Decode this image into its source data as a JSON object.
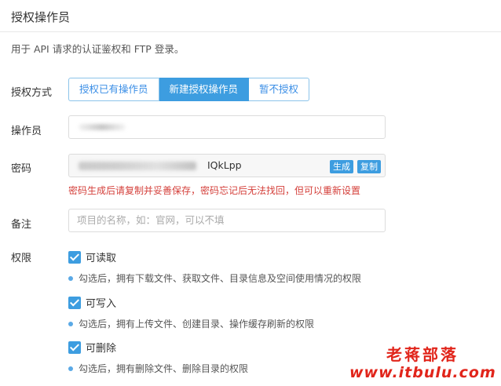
{
  "title": "授权操作员",
  "description": "用于 API 请求的认证鉴权和 FTP 登录。",
  "auth_method": {
    "label": "授权方式",
    "options": [
      "授权已有操作员",
      "新建授权操作员",
      "暂不授权"
    ],
    "selected": "新建授权操作员"
  },
  "operator": {
    "label": "操作员",
    "value": ""
  },
  "password": {
    "label": "密码",
    "visible_tail": "IQkLpp",
    "generate_label": "生成",
    "copy_label": "复制",
    "warning": "密码生成后请复制并妥善保存，密码忘记后无法找回，但可以重新设置"
  },
  "remark": {
    "label": "备注",
    "placeholder": "项目的名称，如：官网，可以不填"
  },
  "permissions": {
    "label": "权限",
    "items": [
      {
        "label": "可读取",
        "checked": true,
        "hint": "勾选后，拥有下载文件、获取文件、目录信息及空间使用情况的权限"
      },
      {
        "label": "可写入",
        "checked": true,
        "hint": "勾选后，拥有上传文件、创建目录、操作缓存刷新的权限"
      },
      {
        "label": "可删除",
        "checked": true,
        "hint": "勾选后，拥有删除文件、删除目录的权限"
      }
    ]
  },
  "watermark": {
    "line1": "老蒋部落",
    "line2": "www.itbulu.com"
  },
  "colors": {
    "primary": "#3d9de0",
    "warning": "#d43f3a",
    "watermark": "#e1251b"
  }
}
